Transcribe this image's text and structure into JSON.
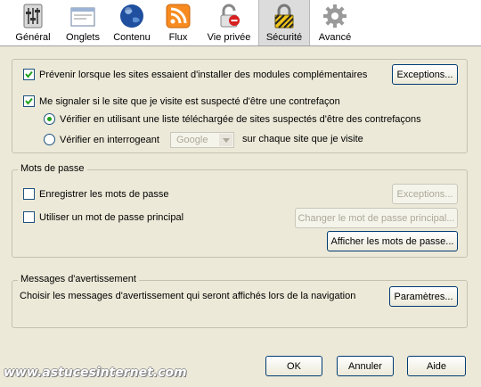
{
  "toolbar": {
    "items": [
      {
        "label": "Général",
        "icon": "general-icon"
      },
      {
        "label": "Onglets",
        "icon": "tabs-icon"
      },
      {
        "label": "Contenu",
        "icon": "globe-icon"
      },
      {
        "label": "Flux",
        "icon": "rss-icon"
      },
      {
        "label": "Vie privée",
        "icon": "privacy-icon"
      },
      {
        "label": "Sécurité",
        "icon": "padlock-icon"
      },
      {
        "label": "Avancé",
        "icon": "gear-icon"
      }
    ],
    "active_index": 5
  },
  "security": {
    "warn_addons_label": "Prévenir lorsque les sites essaient d'installer des modules complémentaires",
    "warn_addons_checked": true,
    "exceptions_label": "Exceptions...",
    "forgery_label": "Me signaler si le site que je visite est suspecté d'être une contrefaçon",
    "forgery_checked": true,
    "radio_list_label": "Vérifier en utilisant une liste téléchargée de sites suspectés d'être des contrefaçons",
    "radio_query_label": "Vérifier en interrogeant",
    "provider_value": "Google",
    "radio_query_suffix": "sur chaque site que je visite"
  },
  "passwords": {
    "legend": "Mots de passe",
    "remember_label": "Enregistrer les mots de passe",
    "remember_checked": false,
    "exceptions_label": "Exceptions...",
    "master_label": "Utiliser un mot de passe principal",
    "master_checked": false,
    "change_master_label": "Changer le mot de passe principal...",
    "show_passwords_label": "Afficher les mots de passe..."
  },
  "warnings": {
    "legend": "Messages d'avertissement",
    "description": "Choisir les messages d'avertissement qui seront affichés lors de la navigation",
    "settings_label": "Paramètres..."
  },
  "footer": {
    "ok_label": "OK",
    "cancel_label": "Annuler",
    "help_label": "Aide"
  },
  "watermark": "www.astucesinternet.com"
}
